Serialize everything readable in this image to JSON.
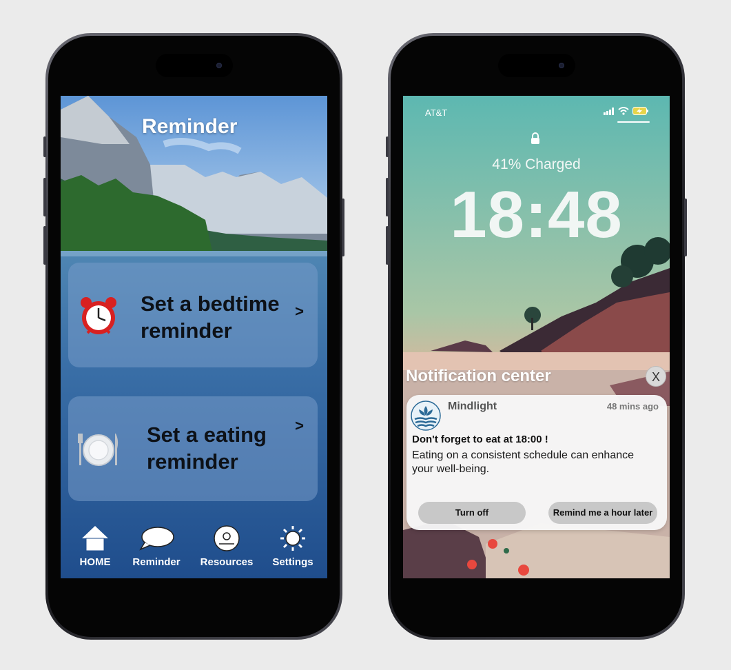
{
  "left_phone": {
    "title": "Reminder",
    "cards": [
      {
        "label_line1": "Set a bedtime",
        "label_line2": "reminder",
        "icon": "alarm-clock-icon",
        "chevron": ">"
      },
      {
        "label_line1": "Set a eating",
        "label_line2": "reminder",
        "icon": "plate-cutlery-icon",
        "chevron": ">"
      }
    ],
    "tabs": [
      {
        "label": "HOME",
        "icon": "home-icon"
      },
      {
        "label": "Reminder",
        "icon": "speech-bubble-icon"
      },
      {
        "label": "Resources",
        "icon": "disc-icon"
      },
      {
        "label": "Settings",
        "icon": "sun-gear-icon"
      }
    ]
  },
  "right_phone": {
    "status": {
      "carrier": "AT&T",
      "icons": [
        "signal-icon",
        "wifi-icon",
        "battery-charging-icon"
      ]
    },
    "charge_text": "41% Charged",
    "clock": "18:48",
    "notification_center": {
      "title": "Notification center",
      "close_label": "X",
      "notification": {
        "app_name": "Mindlight",
        "time_ago": "48 mins ago",
        "headline": "Don't forget to eat at 18:00 !",
        "body": "Eating on a consistent schedule can enhance your well-being.",
        "buttons": {
          "turn_off": "Turn off",
          "remind_later": "Remind me a hour later"
        }
      }
    }
  },
  "colors": {
    "page_bg": "#ebebeb",
    "left_water": "#2c5c96",
    "card_bg": "#769ac8",
    "lockscreen_teal": "#5fb8b0",
    "notif_bg": "#f7f7f7",
    "button_bg": "#c8c8c8"
  }
}
